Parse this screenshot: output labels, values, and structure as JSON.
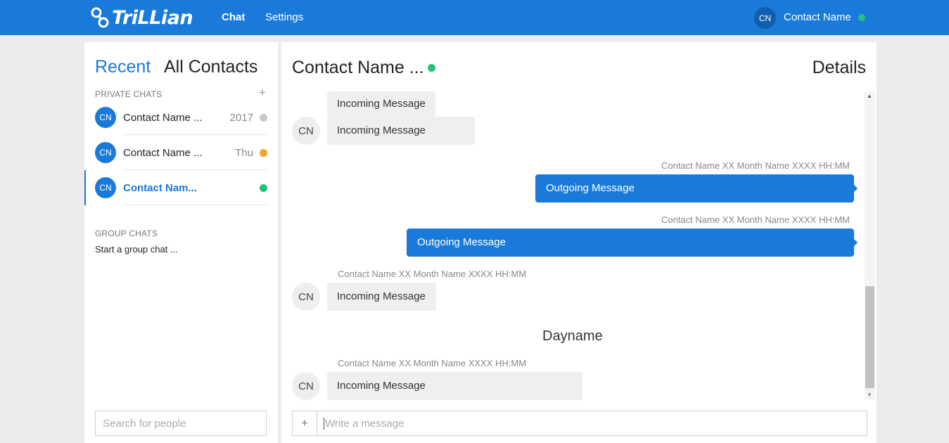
{
  "header": {
    "logo_text": "TriLLian",
    "nav": {
      "chat": "Chat",
      "settings": "Settings"
    },
    "user": {
      "initials": "CN",
      "name": "Contact Name",
      "status_color": "#1ec47a"
    }
  },
  "sidebar": {
    "tabs": {
      "recent": "Recent",
      "all_contacts": "All Contacts"
    },
    "private_chats_label": "PRIVATE CHATS",
    "add_icon": "+",
    "items": [
      {
        "initials": "CN",
        "name": "Contact Name ...",
        "time": "2017",
        "status_color": "#c8c8c8"
      },
      {
        "initials": "CN",
        "name": "Contact Name ...",
        "time": "Thu",
        "status_color": "#f5a623"
      },
      {
        "initials": "CN",
        "name": "Contact Nam...",
        "time": "",
        "status_color": "#1ec47a"
      }
    ],
    "group_chats_label": "GROUP CHATS",
    "start_group": "Start a group chat ...",
    "search_placeholder": "Search for people"
  },
  "conversation": {
    "title": "Contact Name ...",
    "status_color": "#1ec47a",
    "details_label": "Details",
    "messages": {
      "in1": {
        "text": "Incoming Message"
      },
      "in2": {
        "initials": "CN",
        "text": "Incoming Message"
      },
      "out1": {
        "meta": "Contact Name XX Month Name XXXX HH:MM",
        "text": "Outgoing Message"
      },
      "out2": {
        "meta": "Contact Name XX Month Name XXXX HH:MM",
        "text": "Outgoing Message"
      },
      "in3": {
        "initials": "CN",
        "meta": "Contact Name XX Month Name XXXX HH:MM",
        "text": "Incoming Message"
      },
      "in4": {
        "initials": "CN",
        "meta": "Contact Name XX Month Name XXXX HH:MM",
        "text": "Incoming Message"
      }
    },
    "day_separator": "Dayname",
    "composer": {
      "add_icon": "+",
      "placeholder": "Write a message"
    }
  }
}
